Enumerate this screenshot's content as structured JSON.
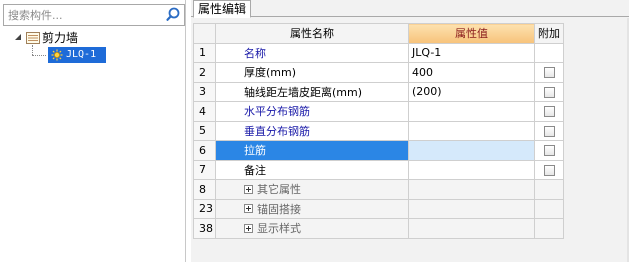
{
  "search": {
    "placeholder": "搜索构件..."
  },
  "tree": {
    "root": {
      "label": "剪力墙",
      "expanded": true
    },
    "children": [
      {
        "label": "JLQ-1",
        "selected": true
      }
    ]
  },
  "tabs": [
    {
      "label": "属性编辑",
      "active": true
    }
  ],
  "grid": {
    "columns": {
      "index": "",
      "name": "属性名称",
      "value": "属性值",
      "extra": "附加"
    },
    "rows": [
      {
        "index": "1",
        "name": "名称",
        "value": "JLQ-1",
        "checkbox": false,
        "blue": true
      },
      {
        "index": "2",
        "name": "厚度(mm)",
        "value": "400",
        "checkbox": true,
        "checked": false
      },
      {
        "index": "3",
        "name": "轴线距左墙皮距离(mm)",
        "value": "(200)",
        "checkbox": true,
        "checked": false
      },
      {
        "index": "4",
        "name": "水平分布钢筋",
        "value": "",
        "checkbox": true,
        "checked": false,
        "blue": true
      },
      {
        "index": "5",
        "name": "垂直分布钢筋",
        "value": "",
        "checkbox": true,
        "checked": false,
        "blue": true
      },
      {
        "index": "6",
        "name": "拉筋",
        "value": "",
        "checkbox": true,
        "checked": false,
        "selected": true
      },
      {
        "index": "7",
        "name": "备注",
        "value": "",
        "checkbox": true,
        "checked": false
      },
      {
        "index": "8",
        "name": "其它属性",
        "group": true
      },
      {
        "index": "23",
        "name": "锚固搭接",
        "group": true
      },
      {
        "index": "38",
        "name": "显示样式",
        "group": true
      }
    ]
  },
  "colors": {
    "selection_blue": "#1e6bd8",
    "value_header_bg": "#f7c27a",
    "value_header_text": "#8b1c1c",
    "link_blue": "#1a1aa8"
  },
  "icons": {
    "search": "search-icon",
    "folder": "folder-icon",
    "component": "component-icon",
    "expand": "plus-expand-icon"
  }
}
